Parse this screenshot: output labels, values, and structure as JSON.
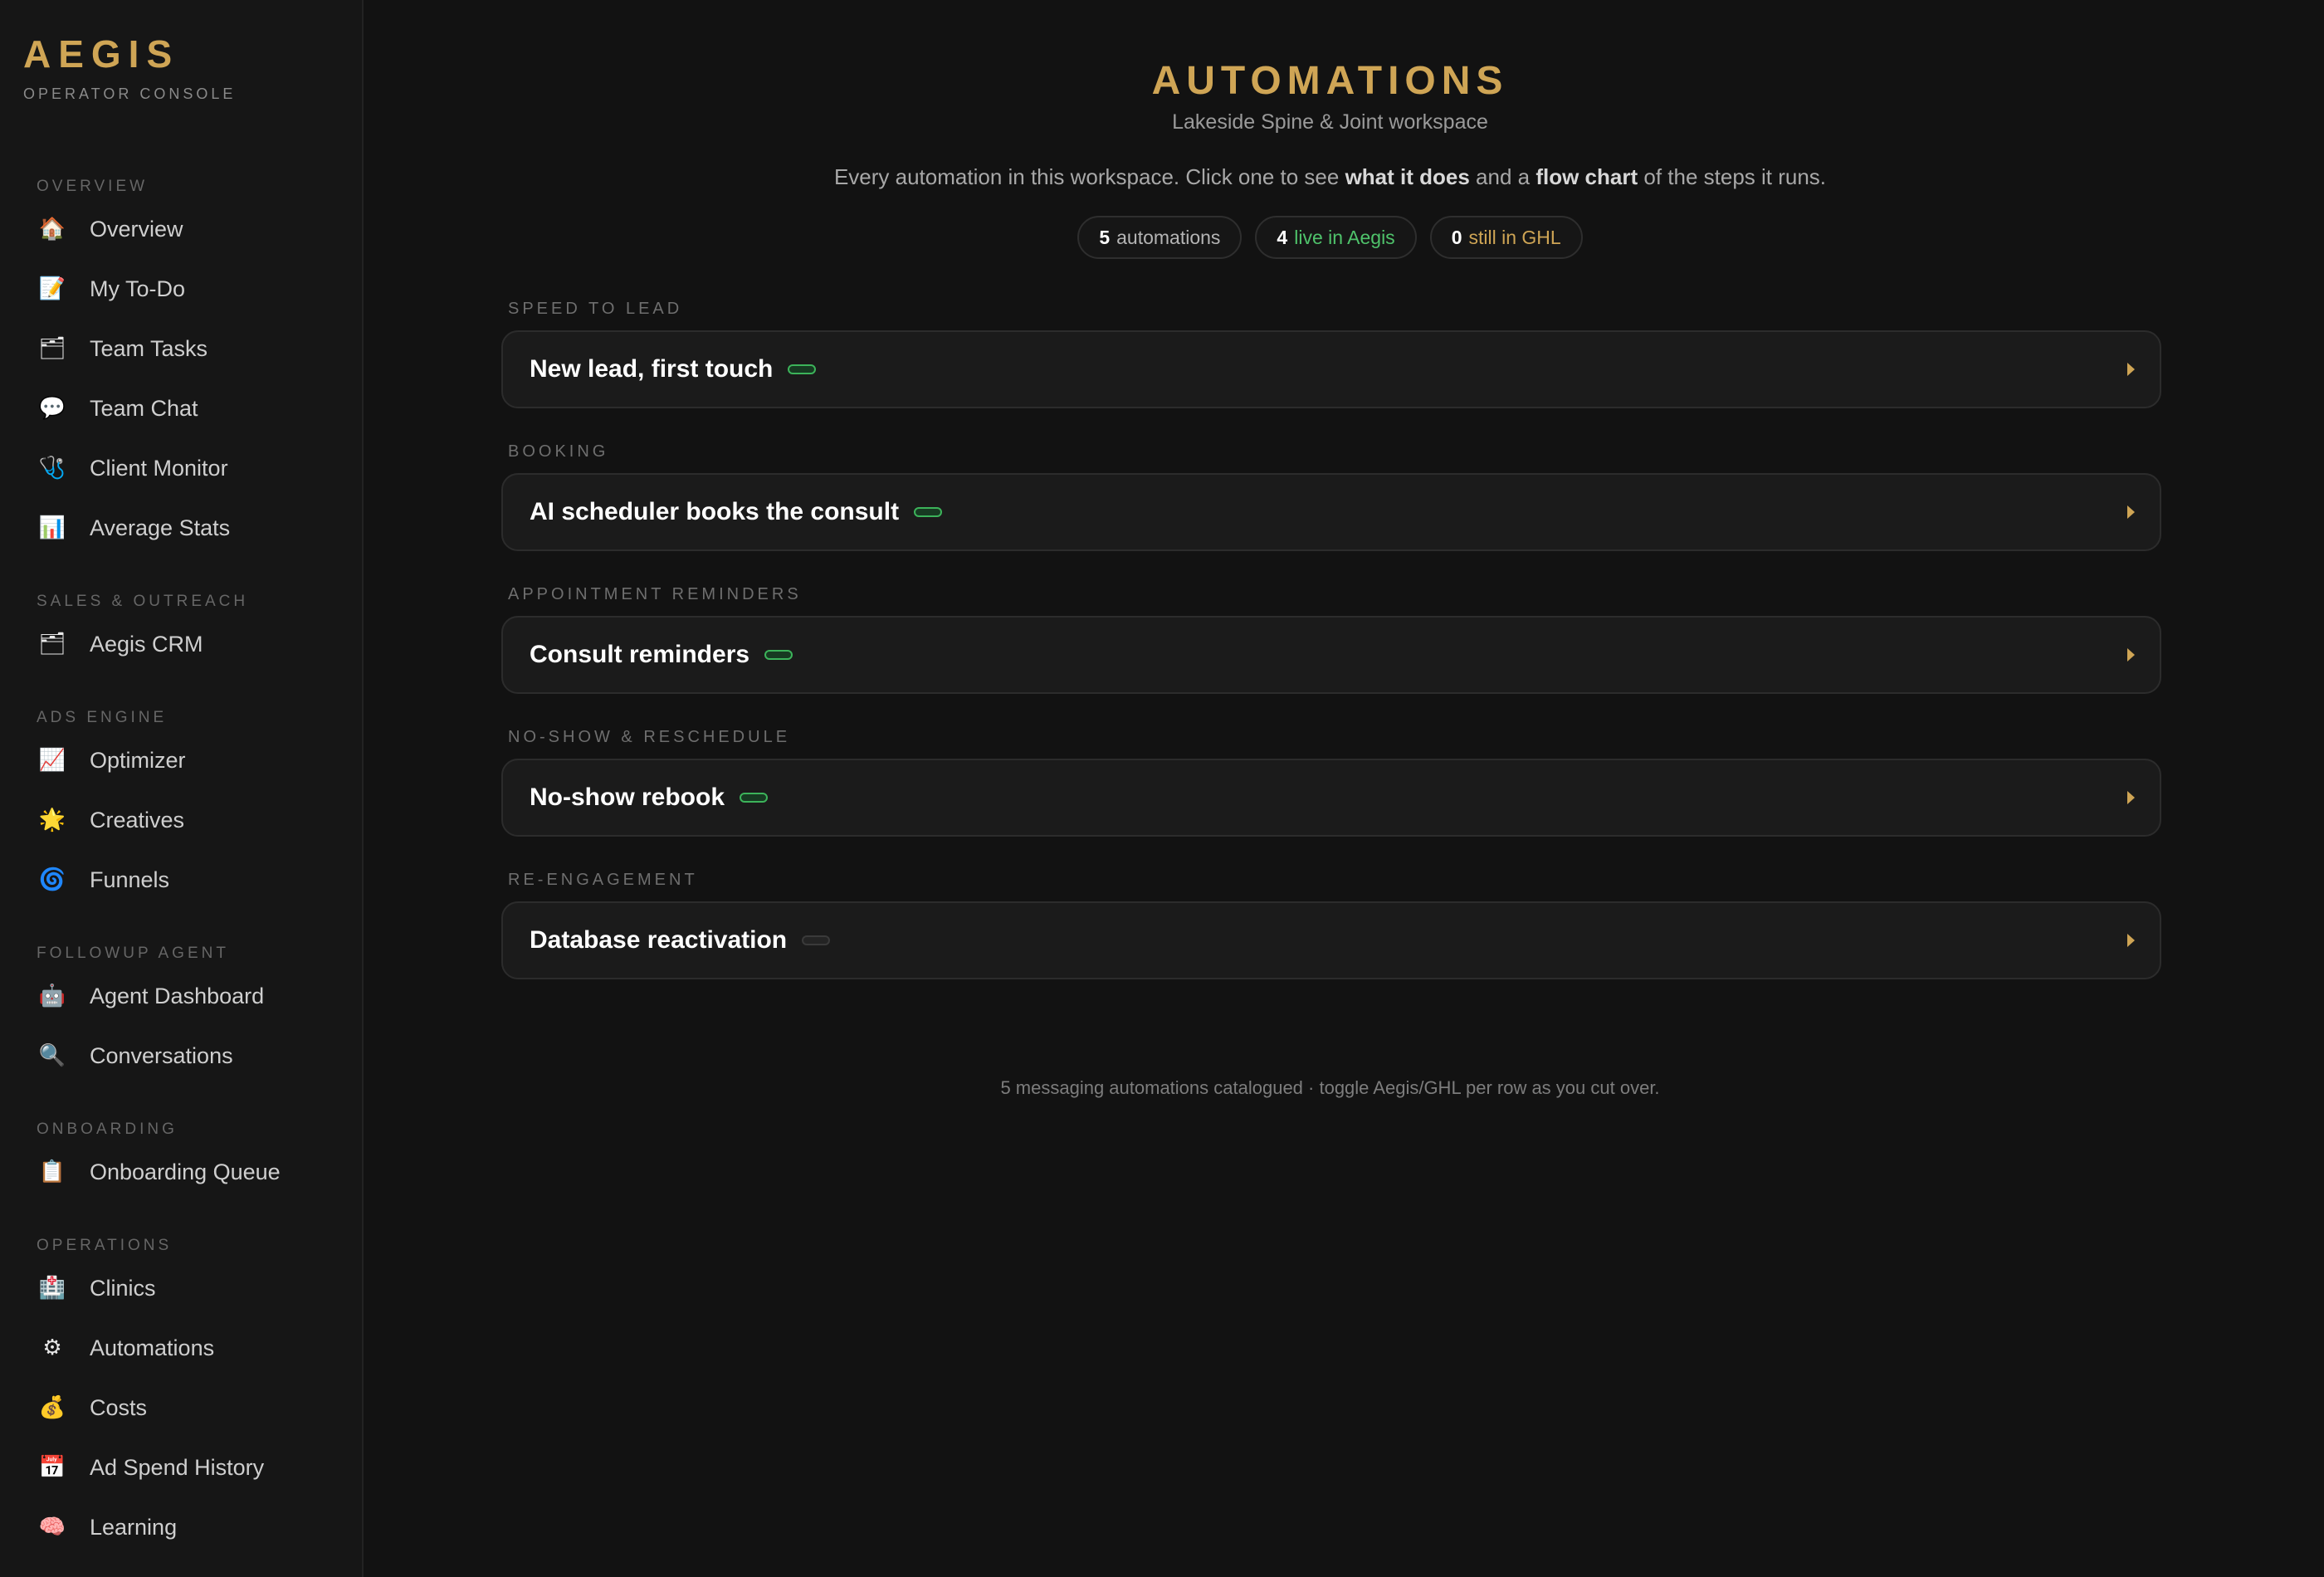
{
  "brand": {
    "name": "AEGIS",
    "subtitle": "OPERATOR CONSOLE"
  },
  "sidebar": {
    "sections": [
      {
        "label": "OVERVIEW",
        "items": [
          {
            "label": "Overview",
            "icon": "🏠",
            "icon_name": "house-icon"
          },
          {
            "label": "My To-Do",
            "icon": "📝",
            "icon_name": "memo-icon"
          },
          {
            "label": "Team Tasks",
            "icon": "🗂",
            "icon_name": "folder-icon"
          },
          {
            "label": "Team Chat",
            "icon": "💬",
            "icon_name": "chat-bubble-icon"
          },
          {
            "label": "Client Monitor",
            "icon": "🩺",
            "icon_name": "stethoscope-icon"
          },
          {
            "label": "Average Stats",
            "icon": "📊",
            "icon_name": "bar-chart-icon"
          }
        ]
      },
      {
        "label": "SALES & OUTREACH",
        "items": [
          {
            "label": "Aegis CRM",
            "icon": "🗂",
            "icon_name": "folder-icon"
          }
        ]
      },
      {
        "label": "ADS ENGINE",
        "items": [
          {
            "label": "Optimizer",
            "icon": "📈",
            "icon_name": "trend-up-icon"
          },
          {
            "label": "Creatives",
            "icon": "🌟",
            "icon_name": "star-icon"
          },
          {
            "label": "Funnels",
            "icon": "🌀",
            "icon_name": "spiral-icon"
          }
        ]
      },
      {
        "label": "FOLLOWUP AGENT",
        "items": [
          {
            "label": "Agent Dashboard",
            "icon": "🤖",
            "icon_name": "robot-icon"
          },
          {
            "label": "Conversations",
            "icon": "🔍",
            "icon_name": "magnifier-icon"
          }
        ]
      },
      {
        "label": "ONBOARDING",
        "items": [
          {
            "label": "Onboarding Queue",
            "icon": "📋",
            "icon_name": "clipboard-icon"
          }
        ]
      },
      {
        "label": "OPERATIONS",
        "items": [
          {
            "label": "Clinics",
            "icon": "🏥",
            "icon_name": "hospital-icon"
          },
          {
            "label": "Automations",
            "icon": "⚙",
            "icon_name": "gear-icon"
          },
          {
            "label": "Costs",
            "icon": "💰",
            "icon_name": "money-bag-icon"
          },
          {
            "label": "Ad Spend History",
            "icon": "📅",
            "icon_name": "calendar-icon"
          },
          {
            "label": "Learning",
            "icon": "🧠",
            "icon_name": "brain-icon"
          }
        ]
      }
    ]
  },
  "main": {
    "title": "AUTOMATIONS",
    "subtitle": "Lakeside Spine & Joint workspace",
    "intro": {
      "part1": "Every automation in this workspace. Click one to see ",
      "bold1": "what it does",
      "part2": " and a ",
      "bold2": "flow chart",
      "part3": " of the steps it runs."
    },
    "stats": {
      "total": {
        "num": "5",
        "label": "automations"
      },
      "live": {
        "num": "4",
        "label": "live in Aegis"
      },
      "ghl": {
        "num": "0",
        "label": "still in GHL"
      }
    },
    "groups": [
      {
        "label": "SPEED TO LEAD",
        "card": {
          "title": "New lead, first touch",
          "live": true
        }
      },
      {
        "label": "BOOKING",
        "card": {
          "title": "AI scheduler books the consult",
          "live": true
        }
      },
      {
        "label": "APPOINTMENT REMINDERS",
        "card": {
          "title": "Consult reminders",
          "live": true
        }
      },
      {
        "label": "NO-SHOW & RESCHEDULE",
        "card": {
          "title": "No-show rebook",
          "live": true
        }
      },
      {
        "label": "RE-ENGAGEMENT",
        "card": {
          "title": "Database reactivation",
          "live": false
        }
      }
    ],
    "footnote": "5 messaging automations catalogued · toggle Aegis/GHL per row as you cut over."
  },
  "colors": {
    "accent": "#cfa555",
    "live": "#4fc36b",
    "background": "#121212",
    "sidebar": "#161616"
  }
}
